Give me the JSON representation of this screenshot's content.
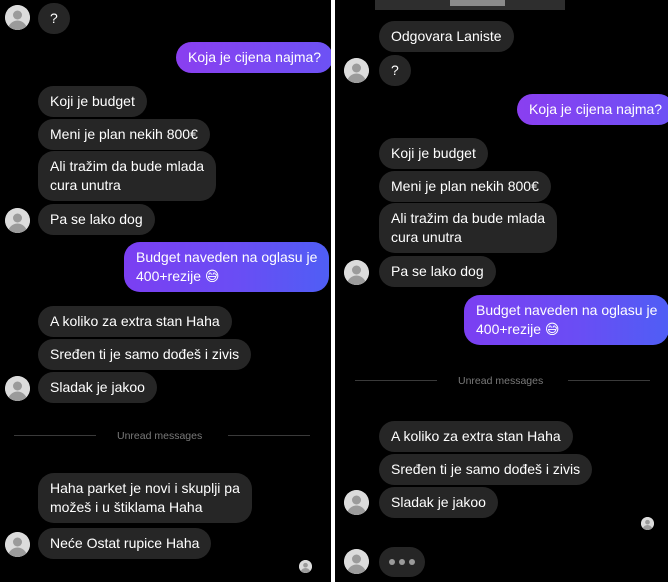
{
  "left": {
    "messages": {
      "q1": "?",
      "price_question": "Koja je cijena najma?",
      "budget_question": "Koji je budget",
      "plan": "Meni je plan nekih 800€",
      "seeking_line1": "Ali tražim da bude mlada",
      "seeking_line2": "cura unutra",
      "dog": "Pa se lako dog",
      "reply_line1": "Budget naveden na oglasu je",
      "reply_line2": "400+rezije 😅",
      "extra": "A koliko za extra stan Haha",
      "sredjen": "Sređen ti je samo dođeš i zivis",
      "sladak": "Sladak je jakoo",
      "parket_line1": "Haha parket je novi i skuplji pa",
      "parket_line2": "možeš i u štiklama Haha",
      "rupice": "Neće Ostat rupice Haha"
    },
    "divider_label": "Unread messages"
  },
  "right": {
    "messages": {
      "odgovara": "Odgovara Laniste",
      "q1": "?",
      "price_question": "Koja je cijena najma?",
      "budget_question": "Koji je budget",
      "plan": "Meni je plan nekih 800€",
      "seeking_line1": "Ali tražim da bude mlada",
      "seeking_line2": "cura unutra",
      "dog": "Pa se lako dog",
      "reply_line1": "Budget naveden na oglasu je",
      "reply_line2": "400+rezije 😅",
      "extra": "A koliko za extra stan Haha",
      "sredjen": "Sređen ti je samo dođeš i zivis",
      "sladak": "Sladak je jakoo"
    },
    "divider_label": "Unread messages"
  },
  "icons": {
    "avatar": "default-avatar-icon",
    "typing": "typing-indicator-icon"
  },
  "colors": {
    "background": "#000000",
    "incoming_bubble": "#262626",
    "outgoing_start": "#7b3ff2",
    "outgoing_end": "#4f5ef5",
    "text": "#ffffff",
    "divider_text": "#7a7a7a"
  }
}
